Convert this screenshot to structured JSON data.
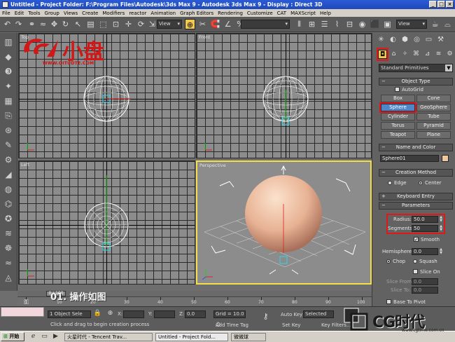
{
  "window": {
    "title": "Untitled   - Project Folder: F:\\Program Files\\Autodesk\\3ds Max 9   - Autodesk 3ds Max 9   - Display : Direct 3D"
  },
  "menu": [
    "File",
    "Edit",
    "Tools",
    "Group",
    "Views",
    "Create",
    "Modifiers",
    "reactor",
    "Animation",
    "Graph Editors",
    "Rendering",
    "Customize",
    "CAT",
    "MAXScript",
    "Help"
  ],
  "toolbar": {
    "view_dropdown_1": "View",
    "view_dropdown_2": "View"
  },
  "logo": {
    "text_cn": "小盘",
    "url": "WWW.QITUDTE.COM"
  },
  "viewports": {
    "top": "Top",
    "front": "Front",
    "left": "Left",
    "perspective": "Perspective"
  },
  "caption": "01. 操作如图",
  "command_panel": {
    "category_dropdown": "Standard Primitives",
    "object_type": {
      "header": "Object Type",
      "autogrid": "AutoGrid",
      "buttons": [
        "Box",
        "Cone",
        "Sphere",
        "GeoSphere",
        "Cylinder",
        "Tube",
        "Torus",
        "Pyramid",
        "Teapot",
        "Plane"
      ],
      "selected": "Sphere"
    },
    "name_color": {
      "header": "Name and Color",
      "name": "Sphere01",
      "color": "#f0c8a0"
    },
    "creation_method": {
      "header": "Creation Method",
      "edge": "Edge",
      "center": "Center"
    },
    "keyboard_entry": "Keyboard Entry",
    "parameters": {
      "header": "Parameters",
      "radius_label": "Radius:",
      "radius": "50.0",
      "segments_label": "Segments:",
      "segments": "50",
      "smooth": "Smooth",
      "hemisphere_label": "Hemisphere:",
      "hemisphere": "0.0",
      "chop": "Chop",
      "squash": "Squash",
      "slice_on": "Slice On",
      "slice_from_label": "Slice From:",
      "slice_from": "0.0",
      "slice_to_label": "Slice To:",
      "slice_to": "0.0",
      "base_to_pivot": "Base To Pivot"
    }
  },
  "timeline": {
    "slider": "0 / 100",
    "ticks": [
      "0",
      "10",
      "20",
      "30",
      "40",
      "50",
      "60",
      "70",
      "80",
      "90",
      "100"
    ]
  },
  "status": {
    "selection": "1 Object Sele",
    "prompt": "Click and drag to begin creation process",
    "x_label": "X:",
    "x_value": "",
    "y_label": "Y:",
    "y_value": "",
    "z_label": "Z:",
    "z_value": "0.0",
    "grid": "Grid = 10.0",
    "add_time_tag": "Add Time Tag",
    "auto_key": "Auto Key",
    "selected": "Selected",
    "set_key": "Set Key",
    "key_filters": "Key Filters..."
  },
  "taskbar": {
    "start": "开始",
    "items": [
      "火星时代 - Tencent Trav...",
      "Untitled   - Project Fold...",
      "微微球"
    ]
  },
  "watermark": {
    "brand": "CG时代",
    "url": "www.cgtime.com.cn"
  }
}
